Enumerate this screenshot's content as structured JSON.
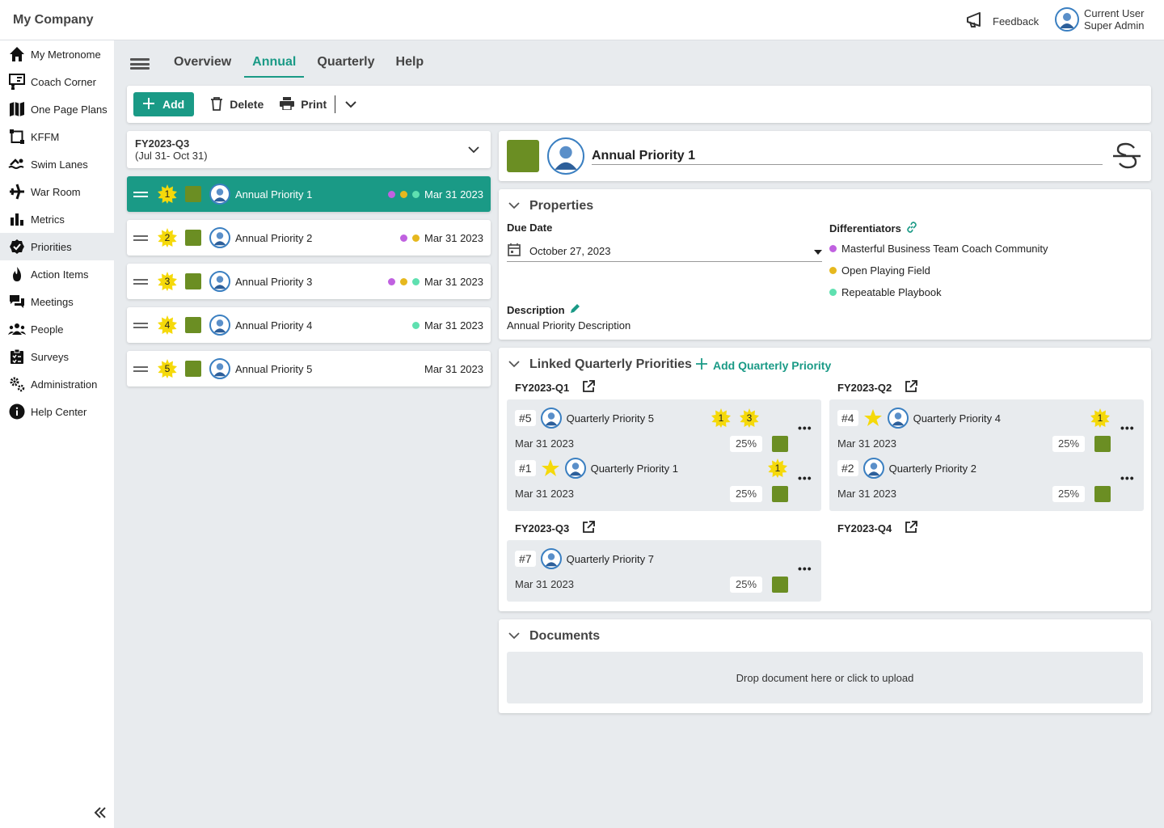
{
  "app": {
    "company": "My Company"
  },
  "header": {
    "feedback": "Feedback",
    "user_name": "Current User",
    "user_role": "Super Admin"
  },
  "sidebar": {
    "items": [
      {
        "label": "My Metronome",
        "icon": "home-icon"
      },
      {
        "label": "Coach Corner",
        "icon": "coach-icon"
      },
      {
        "label": "One Page Plans",
        "icon": "map-icon"
      },
      {
        "label": "KFFM",
        "icon": "flow-icon"
      },
      {
        "label": "Swim Lanes",
        "icon": "swimmer-icon"
      },
      {
        "label": "War Room",
        "icon": "jet-icon"
      },
      {
        "label": "Metrics",
        "icon": "bar-chart-icon"
      },
      {
        "label": "Priorities",
        "icon": "badge-check-icon"
      },
      {
        "label": "Action Items",
        "icon": "fire-icon"
      },
      {
        "label": "Meetings",
        "icon": "chat-icon"
      },
      {
        "label": "People",
        "icon": "people-icon"
      },
      {
        "label": "Surveys",
        "icon": "clipboard-icon"
      },
      {
        "label": "Administration",
        "icon": "gears-icon"
      },
      {
        "label": "Help Center",
        "icon": "info-icon"
      }
    ],
    "active": "Priorities"
  },
  "tabs": [
    "Overview",
    "Annual",
    "Quarterly",
    "Help"
  ],
  "active_tab": "Annual",
  "toolbar": {
    "add": "Add",
    "delete": "Delete",
    "print": "Print"
  },
  "period": {
    "name": "FY2023-Q3",
    "range": "(Jul 31- Oct 31)"
  },
  "annual_priorities": [
    {
      "rank": "1",
      "title": "Annual Priority 1",
      "date": "Mar 31 2023",
      "dots": [
        "#c061e0",
        "#e6b81e",
        "#5fe0b0"
      ],
      "selected": true
    },
    {
      "rank": "2",
      "title": "Annual Priority 2",
      "date": "Mar 31 2023",
      "dots": [
        "#c061e0",
        "#e6b81e"
      ]
    },
    {
      "rank": "3",
      "title": "Annual Priority 3",
      "date": "Mar 31 2023",
      "dots": [
        "#c061e0",
        "#e6b81e",
        "#5fe0b0"
      ]
    },
    {
      "rank": "4",
      "title": "Annual Priority 4",
      "date": "Mar 31 2023",
      "dots": [
        "#5fe0b0"
      ]
    },
    {
      "rank": "5",
      "title": "Annual Priority 5",
      "date": "Mar 31 2023",
      "dots": []
    }
  ],
  "detail": {
    "title": "Annual Priority 1",
    "properties_header": "Properties",
    "due_label": "Due Date",
    "due_value": "October 27, 2023",
    "differentiators_label": "Differentiators",
    "differentiators": [
      {
        "label": "Masterful Business Team Coach Community",
        "color": "#c061e0"
      },
      {
        "label": "Open Playing Field",
        "color": "#e6b81e"
      },
      {
        "label": "Repeatable Playbook",
        "color": "#5fe0b0"
      }
    ],
    "description_label": "Description",
    "description": "Annual Priority Description"
  },
  "linked": {
    "header": "Linked Quarterly Priorities",
    "add": "Add Quarterly Priority",
    "quarters": [
      {
        "name": "FY2023-Q1",
        "items": [
          {
            "num": "#5",
            "title": "Quarterly Priority 5",
            "date": "Mar 31 2023",
            "pct": "25%",
            "badges": [
              "1",
              "3"
            ],
            "star": false
          },
          {
            "num": "#1",
            "title": "Quarterly Priority 1",
            "date": "Mar 31 2023",
            "pct": "25%",
            "badges": [
              "1"
            ],
            "star": true
          }
        ]
      },
      {
        "name": "FY2023-Q2",
        "items": [
          {
            "num": "#4",
            "title": "Quarterly Priority 4",
            "date": "Mar 31 2023",
            "pct": "25%",
            "badges": [
              "1"
            ],
            "star": true
          },
          {
            "num": "#2",
            "title": "Quarterly Priority 2",
            "date": "Mar 31 2023",
            "pct": "25%",
            "badges": [],
            "star": false
          }
        ]
      },
      {
        "name": "FY2023-Q3",
        "items": [
          {
            "num": "#7",
            "title": "Quarterly Priority 7",
            "date": "Mar 31 2023",
            "pct": "25%",
            "badges": [],
            "star": false
          }
        ]
      },
      {
        "name": "FY2023-Q4",
        "items": []
      }
    ]
  },
  "documents": {
    "header": "Documents",
    "drop": "Drop document here or click to upload"
  },
  "colors": {
    "accent": "#1a9a86",
    "status_green": "#6b8e23",
    "badge_yellow": "#f5d90a"
  }
}
